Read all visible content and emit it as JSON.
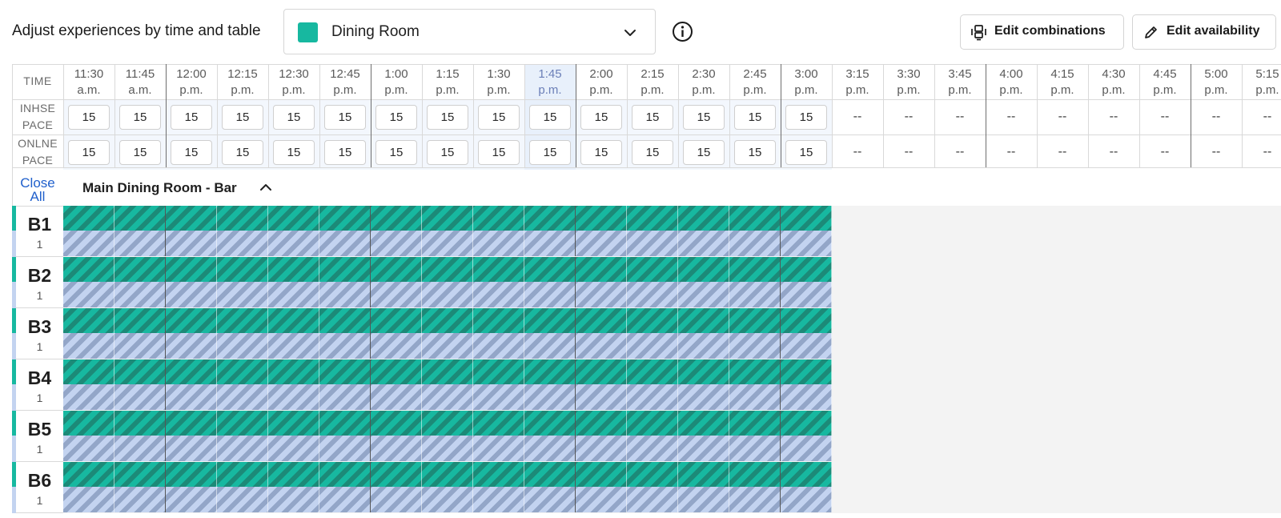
{
  "header": {
    "title": "Adjust experiences by time and table",
    "room_select": {
      "label": "Dining Room",
      "color": "#17b8a0"
    },
    "combos_label": "Edit combinations",
    "avail_label": "Edit availability"
  },
  "grid": {
    "time_label": "TIME",
    "inhouse_label": [
      "INHSE",
      "PACE"
    ],
    "online_label": [
      "ONLNE",
      "PACE"
    ],
    "times": [
      {
        "time": "11:30",
        "period": "a.m."
      },
      {
        "time": "11:45",
        "period": "a.m."
      },
      {
        "time": "12:00",
        "period": "p.m."
      },
      {
        "time": "12:15",
        "period": "p.m."
      },
      {
        "time": "12:30",
        "period": "p.m."
      },
      {
        "time": "12:45",
        "period": "p.m."
      },
      {
        "time": "1:00",
        "period": "p.m."
      },
      {
        "time": "1:15",
        "period": "p.m."
      },
      {
        "time": "1:30",
        "period": "p.m."
      },
      {
        "time": "1:45",
        "period": "p.m."
      },
      {
        "time": "2:00",
        "period": "p.m."
      },
      {
        "time": "2:15",
        "period": "p.m."
      },
      {
        "time": "2:30",
        "period": "p.m."
      },
      {
        "time": "2:45",
        "period": "p.m."
      },
      {
        "time": "3:00",
        "period": "p.m."
      },
      {
        "time": "3:15",
        "period": "p.m."
      },
      {
        "time": "3:30",
        "period": "p.m."
      },
      {
        "time": "3:45",
        "period": "p.m."
      },
      {
        "time": "4:00",
        "period": "p.m."
      },
      {
        "time": "4:15",
        "period": "p.m."
      },
      {
        "time": "4:30",
        "period": "p.m."
      },
      {
        "time": "4:45",
        "period": "p.m."
      },
      {
        "time": "5:00",
        "period": "p.m."
      },
      {
        "time": "5:15",
        "period": "p.m."
      }
    ],
    "highlight_index": 9,
    "inhouse_pace": [
      "15",
      "15",
      "15",
      "15",
      "15",
      "15",
      "15",
      "15",
      "15",
      "15",
      "15",
      "15",
      "15",
      "15",
      "15",
      "--",
      "--",
      "--",
      "--",
      "--",
      "--",
      "--",
      "--",
      "--"
    ],
    "online_pace": [
      "15",
      "15",
      "15",
      "15",
      "15",
      "15",
      "15",
      "15",
      "15",
      "15",
      "15",
      "15",
      "15",
      "15",
      "15",
      "--",
      "--",
      "--",
      "--",
      "--",
      "--",
      "--",
      "--",
      "--"
    ],
    "close_all": [
      "Close",
      "All"
    ],
    "section_title": "Main Dining Room - Bar",
    "tables": [
      {
        "name": "B1",
        "capacity": "1"
      },
      {
        "name": "B2",
        "capacity": "1"
      },
      {
        "name": "B3",
        "capacity": "1"
      },
      {
        "name": "B4",
        "capacity": "1"
      },
      {
        "name": "B5",
        "capacity": "1"
      },
      {
        "name": "B6",
        "capacity": "1"
      }
    ],
    "active_slots": 15
  },
  "colors": {
    "inhouse": "#17b8a0",
    "online": "#c3d3f0",
    "link": "#2060cc",
    "highlight_column": "#e8f0fb",
    "active_column": "#f3f7fd"
  },
  "icons": {
    "room_chevron": "chevron-down-icon",
    "info": "info-icon",
    "combos": "combine-tables-icon",
    "avail": "pencil-icon",
    "section_chevron": "chevron-up-icon"
  }
}
